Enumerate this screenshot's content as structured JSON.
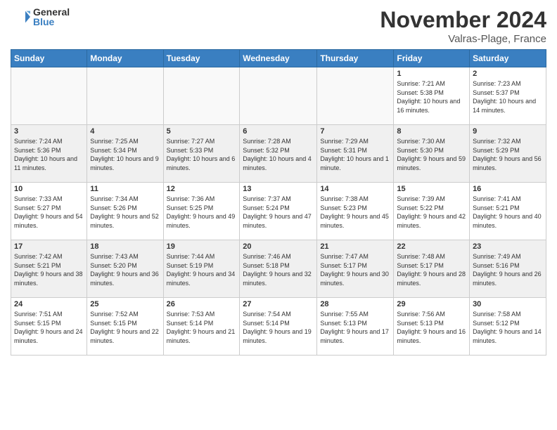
{
  "logo": {
    "general": "General",
    "blue": "Blue"
  },
  "header": {
    "month_title": "November 2024",
    "location": "Valras-Plage, France"
  },
  "days_of_week": [
    "Sunday",
    "Monday",
    "Tuesday",
    "Wednesday",
    "Thursday",
    "Friday",
    "Saturday"
  ],
  "weeks": [
    [
      {
        "day": "",
        "info": ""
      },
      {
        "day": "",
        "info": ""
      },
      {
        "day": "",
        "info": ""
      },
      {
        "day": "",
        "info": ""
      },
      {
        "day": "",
        "info": ""
      },
      {
        "day": "1",
        "info": "Sunrise: 7:21 AM\nSunset: 5:38 PM\nDaylight: 10 hours and 16 minutes."
      },
      {
        "day": "2",
        "info": "Sunrise: 7:23 AM\nSunset: 5:37 PM\nDaylight: 10 hours and 14 minutes."
      }
    ],
    [
      {
        "day": "3",
        "info": "Sunrise: 7:24 AM\nSunset: 5:36 PM\nDaylight: 10 hours and 11 minutes."
      },
      {
        "day": "4",
        "info": "Sunrise: 7:25 AM\nSunset: 5:34 PM\nDaylight: 10 hours and 9 minutes."
      },
      {
        "day": "5",
        "info": "Sunrise: 7:27 AM\nSunset: 5:33 PM\nDaylight: 10 hours and 6 minutes."
      },
      {
        "day": "6",
        "info": "Sunrise: 7:28 AM\nSunset: 5:32 PM\nDaylight: 10 hours and 4 minutes."
      },
      {
        "day": "7",
        "info": "Sunrise: 7:29 AM\nSunset: 5:31 PM\nDaylight: 10 hours and 1 minute."
      },
      {
        "day": "8",
        "info": "Sunrise: 7:30 AM\nSunset: 5:30 PM\nDaylight: 9 hours and 59 minutes."
      },
      {
        "day": "9",
        "info": "Sunrise: 7:32 AM\nSunset: 5:29 PM\nDaylight: 9 hours and 56 minutes."
      }
    ],
    [
      {
        "day": "10",
        "info": "Sunrise: 7:33 AM\nSunset: 5:27 PM\nDaylight: 9 hours and 54 minutes."
      },
      {
        "day": "11",
        "info": "Sunrise: 7:34 AM\nSunset: 5:26 PM\nDaylight: 9 hours and 52 minutes."
      },
      {
        "day": "12",
        "info": "Sunrise: 7:36 AM\nSunset: 5:25 PM\nDaylight: 9 hours and 49 minutes."
      },
      {
        "day": "13",
        "info": "Sunrise: 7:37 AM\nSunset: 5:24 PM\nDaylight: 9 hours and 47 minutes."
      },
      {
        "day": "14",
        "info": "Sunrise: 7:38 AM\nSunset: 5:23 PM\nDaylight: 9 hours and 45 minutes."
      },
      {
        "day": "15",
        "info": "Sunrise: 7:39 AM\nSunset: 5:22 PM\nDaylight: 9 hours and 42 minutes."
      },
      {
        "day": "16",
        "info": "Sunrise: 7:41 AM\nSunset: 5:21 PM\nDaylight: 9 hours and 40 minutes."
      }
    ],
    [
      {
        "day": "17",
        "info": "Sunrise: 7:42 AM\nSunset: 5:21 PM\nDaylight: 9 hours and 38 minutes."
      },
      {
        "day": "18",
        "info": "Sunrise: 7:43 AM\nSunset: 5:20 PM\nDaylight: 9 hours and 36 minutes."
      },
      {
        "day": "19",
        "info": "Sunrise: 7:44 AM\nSunset: 5:19 PM\nDaylight: 9 hours and 34 minutes."
      },
      {
        "day": "20",
        "info": "Sunrise: 7:46 AM\nSunset: 5:18 PM\nDaylight: 9 hours and 32 minutes."
      },
      {
        "day": "21",
        "info": "Sunrise: 7:47 AM\nSunset: 5:17 PM\nDaylight: 9 hours and 30 minutes."
      },
      {
        "day": "22",
        "info": "Sunrise: 7:48 AM\nSunset: 5:17 PM\nDaylight: 9 hours and 28 minutes."
      },
      {
        "day": "23",
        "info": "Sunrise: 7:49 AM\nSunset: 5:16 PM\nDaylight: 9 hours and 26 minutes."
      }
    ],
    [
      {
        "day": "24",
        "info": "Sunrise: 7:51 AM\nSunset: 5:15 PM\nDaylight: 9 hours and 24 minutes."
      },
      {
        "day": "25",
        "info": "Sunrise: 7:52 AM\nSunset: 5:15 PM\nDaylight: 9 hours and 22 minutes."
      },
      {
        "day": "26",
        "info": "Sunrise: 7:53 AM\nSunset: 5:14 PM\nDaylight: 9 hours and 21 minutes."
      },
      {
        "day": "27",
        "info": "Sunrise: 7:54 AM\nSunset: 5:14 PM\nDaylight: 9 hours and 19 minutes."
      },
      {
        "day": "28",
        "info": "Sunrise: 7:55 AM\nSunset: 5:13 PM\nDaylight: 9 hours and 17 minutes."
      },
      {
        "day": "29",
        "info": "Sunrise: 7:56 AM\nSunset: 5:13 PM\nDaylight: 9 hours and 16 minutes."
      },
      {
        "day": "30",
        "info": "Sunrise: 7:58 AM\nSunset: 5:12 PM\nDaylight: 9 hours and 14 minutes."
      }
    ]
  ]
}
